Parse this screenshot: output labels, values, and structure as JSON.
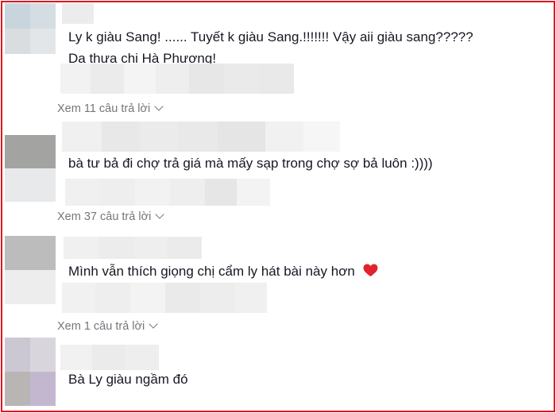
{
  "comments": [
    {
      "lines": [
        "Ly k giàu Sang! ...... Tuyết k giàu Sang.!!!!!!! Vậy aii giàu sang?????",
        "Dạ thưa chị Hà Phương!"
      ],
      "replies_label": "Xem 11 câu trả lời"
    },
    {
      "lines": [
        "bà tư bả đi chợ trả giá mà mấy sạp trong chợ sợ bả luôn :))))"
      ],
      "replies_label": "Xem 37 câu trả lời"
    },
    {
      "lines": [
        "Mình vẫn thích giọng chị cẩm ly hát bài này hơn"
      ],
      "emoji": "red-heart",
      "replies_label": "Xem 1 câu trả lời"
    },
    {
      "lines": [
        "Bà Ly giàu ngầm đó"
      ]
    }
  ],
  "colors": {
    "border": "#e0161e",
    "text": "#161823",
    "muted": "#75767c",
    "heart": "#e0232e"
  }
}
